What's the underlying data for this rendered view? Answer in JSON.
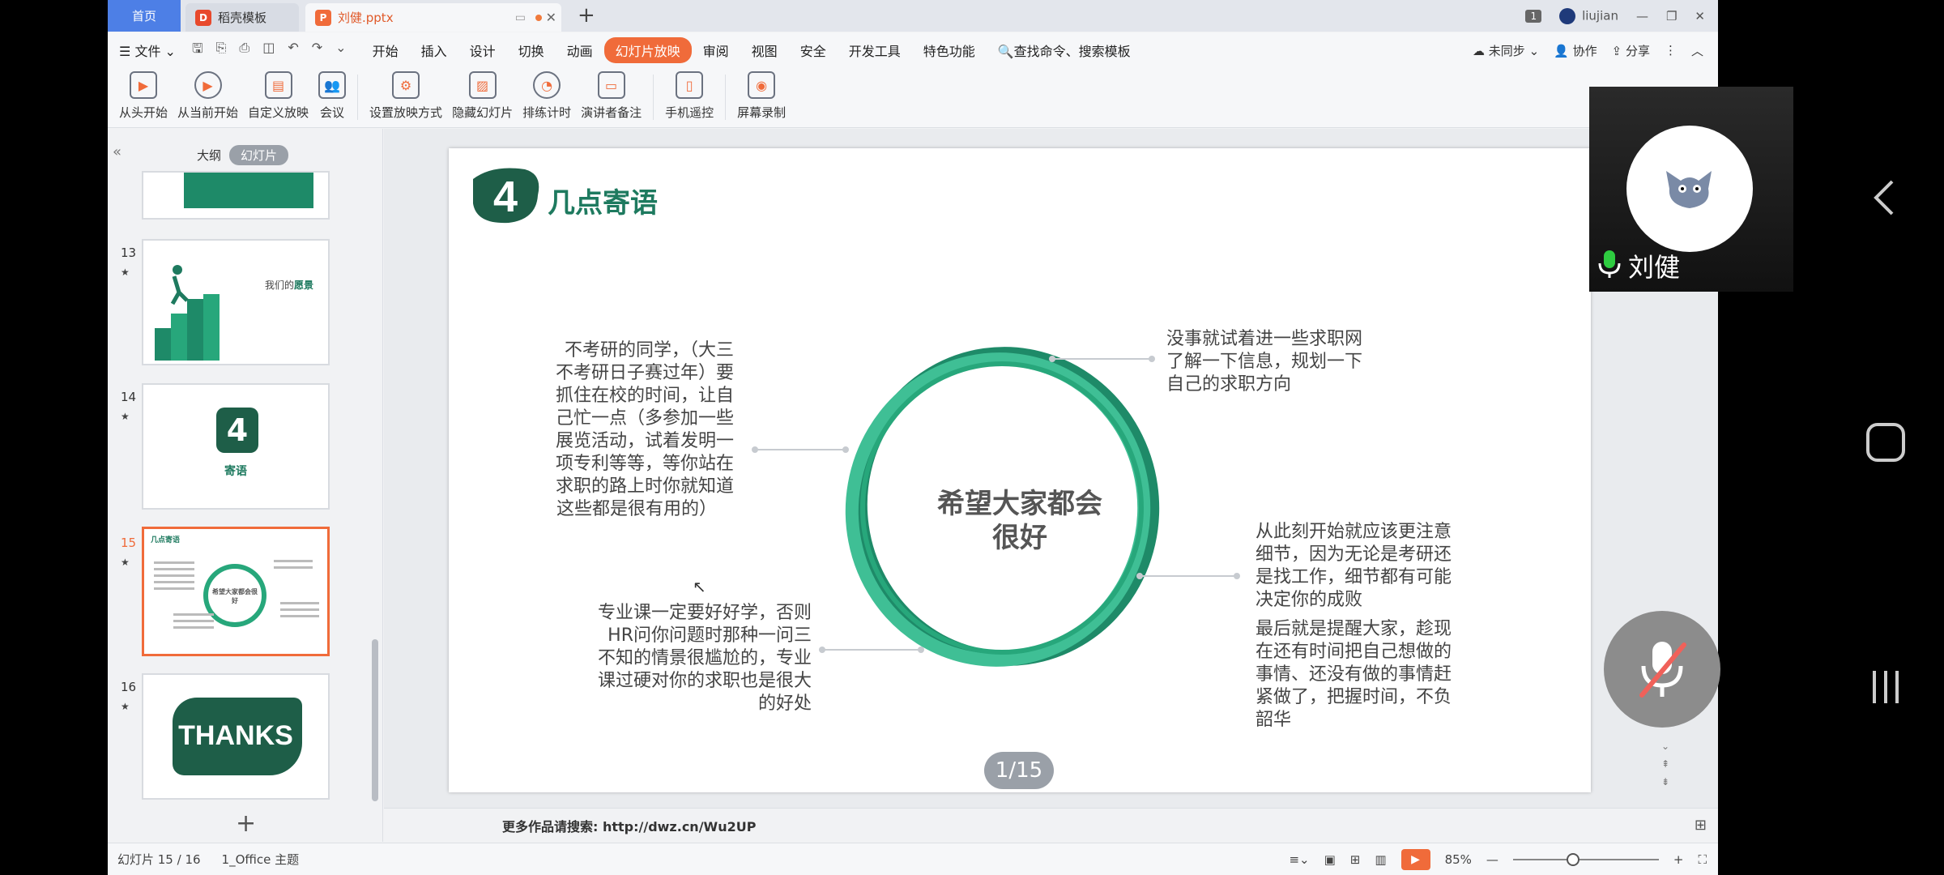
{
  "titlebar": {
    "tabs": [
      {
        "label": "首页"
      },
      {
        "label": "稻壳模板"
      },
      {
        "label": "刘健.pptx"
      }
    ],
    "window_count": "1",
    "user": "liujian"
  },
  "menu": {
    "file": "文件",
    "items": [
      "开始",
      "插入",
      "设计",
      "切换",
      "动画",
      "幻灯片放映",
      "审阅",
      "视图",
      "安全",
      "开发工具",
      "特色功能"
    ],
    "active": "幻灯片放映",
    "search": "查找命令、搜索模板",
    "right": {
      "sync": "未同步",
      "collab": "协作",
      "share": "分享"
    }
  },
  "ribbon": {
    "buttons": [
      "从头开始",
      "从当前开始",
      "自定义放映",
      "会议",
      "设置放映方式",
      "隐藏幻灯片",
      "排练计时",
      "演讲者备注",
      "手机遥控",
      "屏幕录制"
    ]
  },
  "leftpane": {
    "tab_outline": "大纲",
    "tab_slides": "幻灯片",
    "thumbs": [
      {
        "num": "13",
        "title": "我们的",
        "title_hl": "愿景"
      },
      {
        "num": "14",
        "label": "寄语"
      },
      {
        "num": "15",
        "title": "几点寄语",
        "center": "希望大家都会很好"
      },
      {
        "num": "16",
        "label": "THANKS"
      }
    ]
  },
  "slide": {
    "number_mark": "4",
    "title": "几点寄语",
    "center": [
      "希望大家都会",
      "很好"
    ],
    "texts": {
      "left": [
        "不考研的同学，（大三",
        "不考研日子赛过年）要",
        "抓住在校的时间，让自",
        "己忙一点（多参加一些",
        "展览活动，试着发明一",
        "项专利等等，等你站在",
        "求职的路上时你就知道",
        "这些都是很有用的）"
      ],
      "top_right": [
        "没事就试着进一些求职网",
        "了解一下信息，规划一下",
        "自己的求职方向"
      ],
      "bottom_left": [
        "专业课一定要好好学，否则",
        "HR问你问题时那种一问三",
        "不知的情景很尴尬的，专业",
        "课过硬对你的求职也是很大",
        "的好处"
      ],
      "right": [
        "从此刻开始就应该更注意",
        "细节，因为无论是考研还",
        "是找工作，细节都有可能",
        "决定你的成败"
      ],
      "bottom_right": [
        "最后就是提醒大家，趁现",
        "在还有时间把自己想做的",
        "事情、还没有做的事情赶",
        "紧做了，把握时间，不负",
        "韶华"
      ]
    },
    "page_indicator": "1/15"
  },
  "notes": {
    "text": "更多作品请搜索: http://dwz.cn/Wu2UP"
  },
  "status": {
    "slide_info": "幻灯片 15 / 16",
    "theme": "1_Office 主题",
    "zoom": "85%"
  },
  "video": {
    "name": "刘健"
  },
  "colors": {
    "accent": "#f06b3a",
    "brand_green": "#1e7a5f",
    "home_tab": "#4d7fe6"
  }
}
